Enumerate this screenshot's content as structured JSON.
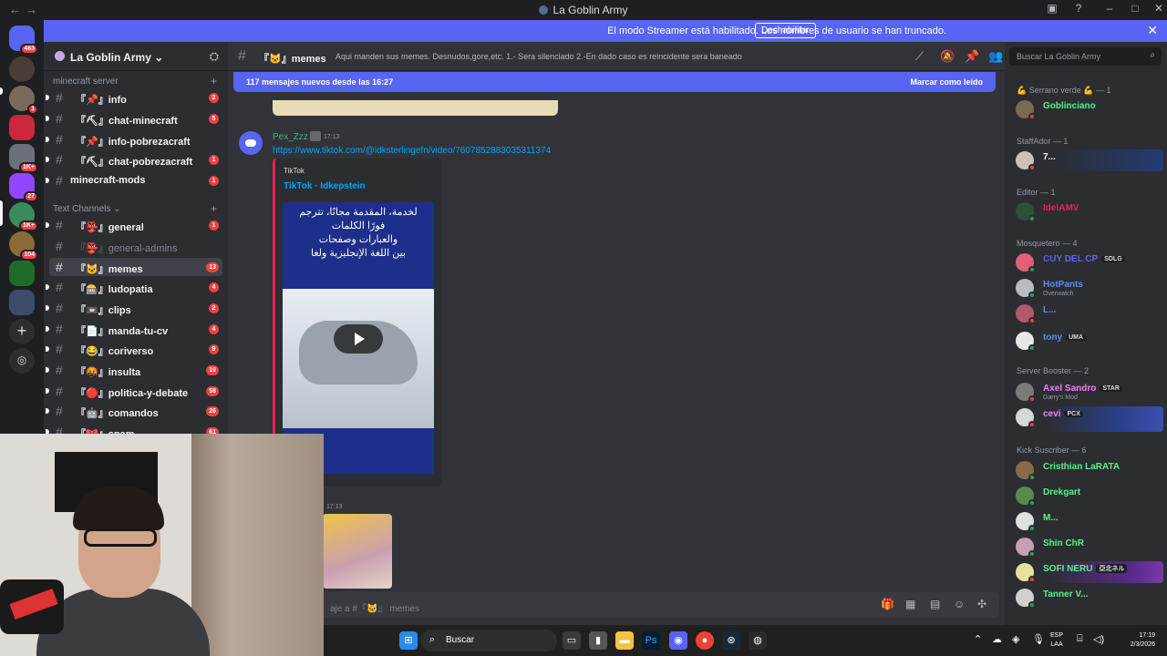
{
  "window": {
    "title": "La Goblin Army"
  },
  "banner": {
    "message": "El modo Streamer está habilitado. Los nombres de usuario se han truncado.",
    "button": "Deshabilitar"
  },
  "rail": {
    "badges": [
      "463",
      "1",
      "1K+",
      "27",
      "1K+",
      "104"
    ]
  },
  "server": {
    "name": "La Goblin Army",
    "categories": [
      {
        "name": "minecraft server"
      },
      {
        "name": "Text Channels"
      }
    ],
    "channels": [
      {
        "label": "『📌』info",
        "count": "2"
      },
      {
        "label": "『⛏』chat-minecraft",
        "count": "5"
      },
      {
        "label": "『📌』info-pobrezacraft",
        "count": "1"
      },
      {
        "label": "『⛏』chat-pobrezacraft",
        "count": "1"
      },
      {
        "label": "minecraft-mods",
        "count": "1"
      },
      {
        "label": "『👺』general",
        "count": "1"
      },
      {
        "label": "『👺』general-admins",
        "count": ""
      },
      {
        "label": "『🐱』memes",
        "count": "13"
      },
      {
        "label": "『🎰』ludopatia",
        "count": "4"
      },
      {
        "label": "『📼』clips",
        "count": "2"
      },
      {
        "label": "『📄』manda-tu-cv",
        "count": "4"
      },
      {
        "label": "『😂』coriverso",
        "count": "9"
      },
      {
        "label": "『🤬』insulta",
        "count": "10"
      },
      {
        "label": "『🔴』politica-y-debate",
        "count": "58"
      },
      {
        "label": "『🤖』comandos",
        "count": "26"
      },
      {
        "label": "『🎀』spam",
        "count": "61"
      }
    ]
  },
  "channel": {
    "name": "『🐱』memes",
    "topic": "Aqui manden sus memes. Desnudos,gore,etc. 1.- Sera silenciado 2.-En dado caso es reincidente sera baneado",
    "new_messages": "117 mensajes nuevos desde las 16:27",
    "mark_read": "Marcar como leído",
    "composer_placeholder": "aje a #『🐱』 memes"
  },
  "message": {
    "author": "Pex_Zzz",
    "time": "17:13",
    "link": "https://www.tiktok.com/@idksterlingefn/video/7607852883035311374",
    "embed_provider": "TikTok",
    "embed_title": "TikTok · Idkepstein",
    "thumb_text": "لخدمة، المقدمة مجانًا، تترجم\nفورًا الكلمات\nوالعبارات وصفحات\nبين اللغة الإنجليزية ولغا",
    "time2": "17:13"
  },
  "members": {
    "search_placeholder": "Buscar La Goblin Army",
    "roles": [
      {
        "label": "💪 Serrano verde 💪 — 1"
      },
      {
        "label": "StaffAdor — 1"
      },
      {
        "label": "Editor — 1"
      },
      {
        "label": "Mosquetero — 4"
      },
      {
        "label": "Server Booster — 2"
      },
      {
        "label": "Kick Suscriber — 6"
      }
    ],
    "list": [
      {
        "name": "Goblinciano",
        "color": "#57f287",
        "tag": "",
        "sub": ""
      },
      {
        "name": "7...",
        "color": "#f2f3f5",
        "tag": "",
        "sub": ""
      },
      {
        "name": "IdelAMV",
        "color": "#e91e63",
        "tag": "",
        "sub": ""
      },
      {
        "name": "CUY DEL CP",
        "color": "#5865f2",
        "tag": "SDLG",
        "sub": ""
      },
      {
        "name": "HotPants",
        "color": "#5b8def",
        "tag": "",
        "sub": "Overwatch"
      },
      {
        "name": "L...",
        "color": "#5b8def",
        "tag": "",
        "sub": ""
      },
      {
        "name": "tony",
        "color": "#5b8def",
        "tag": "UMA",
        "sub": ""
      },
      {
        "name": "Axel Sandro",
        "color": "#f47fff",
        "tag": "STAR",
        "sub": "Garry's Mod"
      },
      {
        "name": "cevi",
        "color": "#f47fff",
        "tag": "PCX",
        "sub": ""
      },
      {
        "name": "Cristhian LaRATA",
        "color": "#57f287",
        "tag": "",
        "sub": ""
      },
      {
        "name": "Drekgart",
        "color": "#57f287",
        "tag": "",
        "sub": ""
      },
      {
        "name": "M...",
        "color": "#57f287",
        "tag": "",
        "sub": ""
      },
      {
        "name": "Shin ChR",
        "color": "#57f287",
        "tag": "",
        "sub": ""
      },
      {
        "name": "SOFI NERU",
        "color": "#57f287",
        "tag": "亞北ネル",
        "sub": ""
      },
      {
        "name": "Tanner V...",
        "color": "#57f287",
        "tag": "",
        "sub": ""
      }
    ]
  },
  "taskbar": {
    "search_placeholder": "Buscar",
    "lang_top": "ESP",
    "lang_bottom": "LAA",
    "time": "17:19",
    "date": "2/3/2026"
  },
  "colors": {
    "accent": "#5865f2",
    "unread": "#f23f43",
    "online": "#23a55a",
    "dnd": "#f23f43"
  }
}
